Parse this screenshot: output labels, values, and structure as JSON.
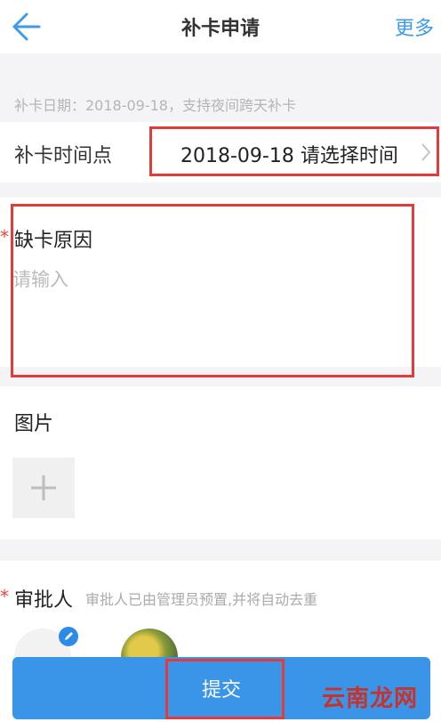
{
  "header": {
    "title": "补卡申请",
    "more_label": "更多",
    "back_icon": "arrow-left-icon"
  },
  "hint": "补卡日期：2018-09-18，支持夜间跨天补卡",
  "time_row": {
    "label": "补卡时间点",
    "value": "2018-09-18 请选择时间",
    "chevron_icon": "chevron-right-icon"
  },
  "reason": {
    "required_mark": "*",
    "label": "缺卡原因",
    "placeholder": "请输入"
  },
  "photo": {
    "label": "图片",
    "add_icon": "plus-icon"
  },
  "approver": {
    "required_mark": "*",
    "label": "审批人",
    "note": "审批人已由管理员预置,并将自动去重",
    "edit_icon": "pencil-icon"
  },
  "submit": {
    "label": "提交"
  },
  "watermark": "云南龙网",
  "colors": {
    "accent": "#3a95e8",
    "highlight": "#e33b3b",
    "required": "#e8493d"
  }
}
